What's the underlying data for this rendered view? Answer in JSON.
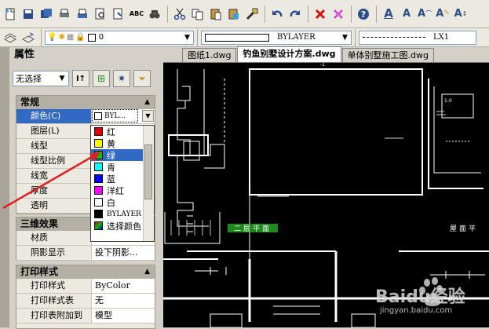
{
  "toolbar_row2": {
    "layer_value": "0",
    "color_value": "BYLAYER",
    "linetype_value": "LX1"
  },
  "palette": {
    "title": "属性",
    "selection_value": "无选择"
  },
  "sections": {
    "general": {
      "title": "常规",
      "rows": [
        {
          "name": "颜色(C)",
          "value": "BYL..."
        },
        {
          "name": "图层(L)",
          "value": ""
        },
        {
          "name": "线型",
          "value": ""
        },
        {
          "name": "线型比例",
          "value": ""
        },
        {
          "name": "线宽",
          "value": ""
        },
        {
          "name": "厚度",
          "value": ""
        },
        {
          "name": "透明",
          "value": ""
        }
      ]
    },
    "threed": {
      "title": "三维效果",
      "rows": [
        {
          "name": "材质",
          "value": ""
        },
        {
          "name": "阴影显示",
          "value": "投下阴影..."
        }
      ]
    },
    "plot": {
      "title": "打印样式",
      "rows": [
        {
          "name": "打印样式",
          "value": "ByColor"
        },
        {
          "name": "打印样式表",
          "value": "无"
        },
        {
          "name": "打印表附加到",
          "value": "模型"
        }
      ]
    }
  },
  "color_dropdown": [
    {
      "label": "红",
      "color": "#e00000"
    },
    {
      "label": "黄",
      "color": "#ffff00"
    },
    {
      "label": "绿",
      "color": "#00c000"
    },
    {
      "label": "青",
      "color": "#00ffff"
    },
    {
      "label": "蓝",
      "color": "#0000ff"
    },
    {
      "label": "洋红",
      "color": "#ff00ff"
    },
    {
      "label": "白",
      "color": "#ffffff"
    },
    {
      "label": "BYLAYER",
      "color": "#000000"
    },
    {
      "label": "选择颜色",
      "color": "#3a6a9a"
    }
  ],
  "tabs": [
    {
      "label": "图纸1.dwg"
    },
    {
      "label": "钓鱼别墅设计方案.dwg"
    },
    {
      "label": "单体别墅施工图.dwg"
    }
  ],
  "drawing": {
    "label_left": "二层平面",
    "label_right": "屋面平"
  },
  "watermark": {
    "brand": "Baidu经验",
    "url": "jingyan.baidu.com"
  },
  "colors": {
    "selection": "#316ac5",
    "annotation_arrow": "#e02020",
    "label_green": "#1e8a1e"
  }
}
